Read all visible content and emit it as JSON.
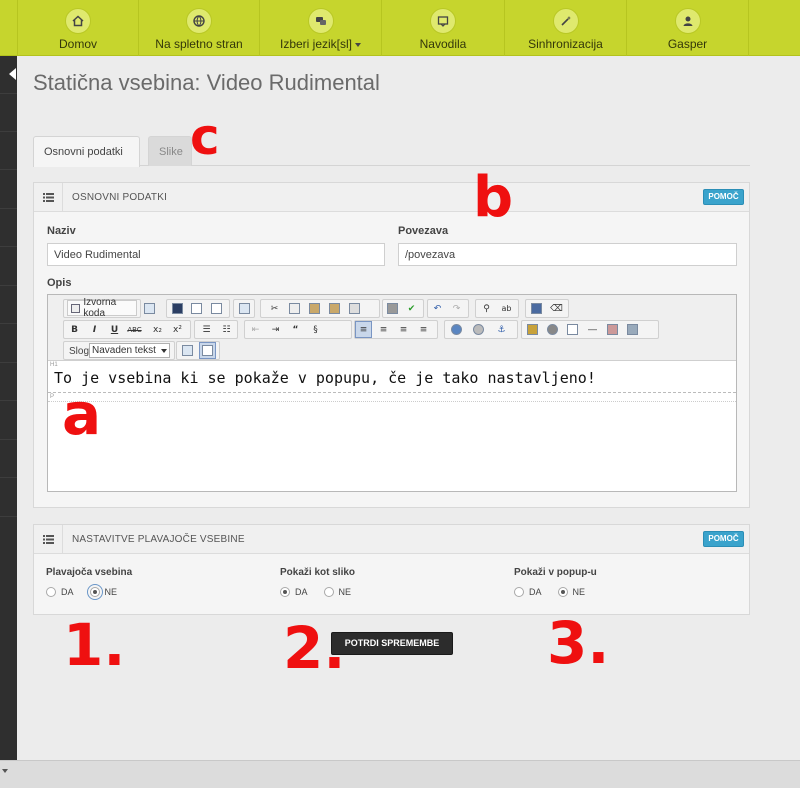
{
  "nav": {
    "items": [
      {
        "label": "Domov",
        "icon": "home-icon"
      },
      {
        "label": "Na spletno stran",
        "icon": "globe-icon"
      },
      {
        "label": "Izberi jezik[sl]",
        "icon": "language-icon",
        "has_dropdown": true
      },
      {
        "label": "Navodila",
        "icon": "instructions-icon"
      },
      {
        "label": "Sinhronizacija",
        "icon": "sync-wand-icon"
      },
      {
        "label": "Gasper",
        "icon": "user-icon"
      }
    ],
    "bar_color": "#c6d52d"
  },
  "page": {
    "title": "Statična vsebina: Video Rudimental"
  },
  "tabs": [
    {
      "label": "Osnovni podatki",
      "active": true
    },
    {
      "label": "Slike",
      "active": false
    }
  ],
  "basic_panel": {
    "title": "OSNOVNI PODATKI",
    "help_label": "POMOČ",
    "naziv": {
      "label": "Naziv",
      "value": "Video Rudimental"
    },
    "povezava": {
      "label": "Povezava",
      "value": "/povezava"
    },
    "opis": {
      "label": "Opis"
    },
    "editor": {
      "source_button": "Izvorna koda",
      "style_label": "Slog",
      "style_value": "Navaden tekst",
      "block_h1_tag": "H1",
      "block_p_tag": "P",
      "content_heading": "To je vsebina ki se pokaže v popupu, če je tako nastavljeno!"
    }
  },
  "float_panel": {
    "title": "NASTAVITVE PLAVAJOČE VSEBINE",
    "help_label": "POMOČ",
    "groups": [
      {
        "label": "Plavajoča vsebina",
        "options": [
          "DA",
          "NE"
        ],
        "selected": "NE"
      },
      {
        "label": "Pokaži kot sliko",
        "options": [
          "DA",
          "NE"
        ],
        "selected": "DA"
      },
      {
        "label": "Pokaži v popup-u",
        "options": [
          "DA",
          "NE"
        ],
        "selected": "NE"
      }
    ]
  },
  "submit_label": "POTRDI SPREMEMBE",
  "annotations": {
    "a": "a",
    "b": "b",
    "c": "c",
    "one": "1.",
    "two": "2.",
    "three": "3."
  },
  "colors": {
    "accent": "#3aa3cc",
    "annotation": "#ef1010",
    "dark_button": "#2c2c2c"
  }
}
